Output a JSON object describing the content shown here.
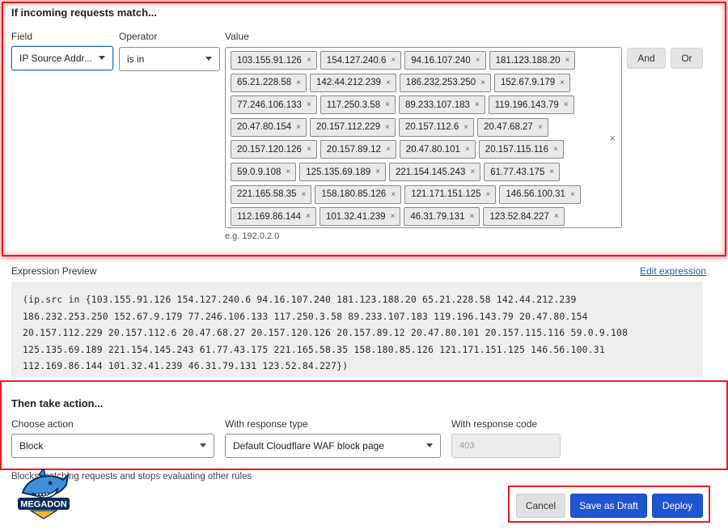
{
  "match": {
    "title": "If incoming requests match...",
    "field_label": "Field",
    "operator_label": "Operator",
    "value_label": "Value",
    "field_value": "IP Source Addr...",
    "operator_value": "is in",
    "value_rows": [
      [
        "103.155.91.126",
        "154.127.240.6",
        "94.16.107.240",
        "181.123.188.20"
      ],
      [
        "65.21.228.58",
        "142.44.212.239",
        "186.232.253.250",
        "152.67.9.179"
      ],
      [
        "77.246.106.133",
        "117.250.3.58",
        "89.233.107.183",
        "119.196.143.79"
      ],
      [
        "20.47.80.154",
        "20.157.112.229",
        "20.157.112.6",
        "20.47.68.27"
      ],
      [
        "20.157.120.126",
        "20.157.89.12",
        "20.47.80.101",
        "20.157.115.116"
      ],
      [
        "59.0.9.108",
        "125.135.69.189",
        "221.154.145.243",
        "61.77.43.175"
      ],
      [
        "221.165.58.35",
        "158.180.85.126",
        "121.171.151.125",
        "146.56.100.31"
      ],
      [
        "112.169.86.144",
        "101.32.41.239",
        "46.31.79.131",
        "123.52.84.227"
      ]
    ],
    "chip_remove": "×",
    "clear_all": "×",
    "and_label": "And",
    "or_label": "Or",
    "hint": "e.g. 192.0.2.0"
  },
  "preview": {
    "title": "Expression Preview",
    "edit_link": "Edit expression",
    "lines": [
      "(ip.src in {103.155.91.126 154.127.240.6 94.16.107.240 181.123.188.20 65.21.228.58 142.44.212.239",
      "186.232.253.250 152.67.9.179 77.246.106.133 117.250.3.58 89.233.107.183 119.196.143.79 20.47.80.154",
      "20.157.112.229 20.157.112.6 20.47.68.27 20.157.120.126 20.157.89.12 20.47.80.101 20.157.115.116 59.0.9.108",
      "125.135.69.189 221.154.145.243 61.77.43.175 221.165.58.35 158.180.85.126 121.171.151.125 146.56.100.31",
      "112.169.86.144 101.32.41.239 46.31.79.131 123.52.84.227})"
    ]
  },
  "action": {
    "title": "Then take action...",
    "choose_label": "Choose action",
    "choose_value": "Block",
    "response_type_label": "With response type",
    "response_type_value": "Default Cloudflare WAF block page",
    "response_code_label": "With response code",
    "response_code_placeholder": "403",
    "note": "Blocks matching requests and stops evaluating other rules"
  },
  "footer": {
    "cancel_label": "Cancel",
    "draft_label": "Save as Draft",
    "deploy_label": "Deploy"
  },
  "logo": {
    "text": "MEGADON"
  },
  "colors": {
    "highlight_red": "#ee1c24",
    "primary_blue": "#1f55d1",
    "link_blue": "#1f5bb5"
  }
}
